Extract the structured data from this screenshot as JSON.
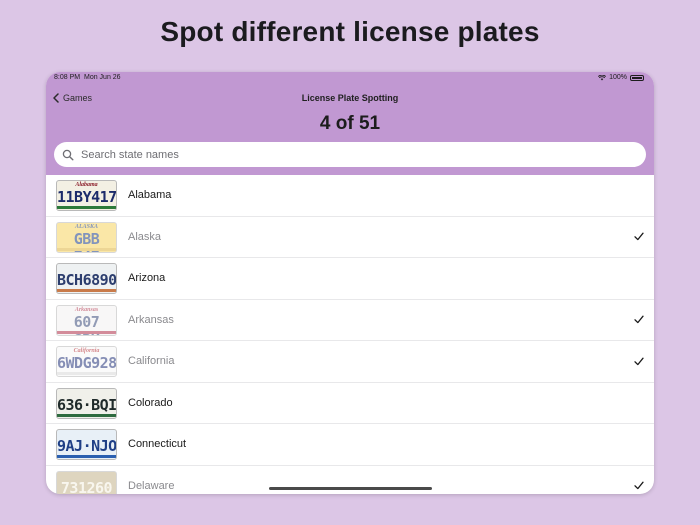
{
  "headline": "Spot different license plates",
  "status_bar": {
    "time": "8:08 PM",
    "date": "Mon Jun 26",
    "battery": "100%"
  },
  "nav": {
    "back_label": "Games",
    "title": "License Plate Spotting"
  },
  "progress": "4 of 51",
  "search": {
    "placeholder": "Search state names"
  },
  "states": [
    {
      "name": "Alabama",
      "spotted": false,
      "plate_text": "11BY417",
      "plate_top": "Alabama",
      "bg": "#f3f0e4",
      "text_color": "#1c2b6b",
      "top_color": "#8a1d2a",
      "accent": "#2c7a3a"
    },
    {
      "name": "Alaska",
      "spotted": true,
      "plate_text": "GBB 747",
      "plate_top": "ALASKA",
      "bg": "#f6d560",
      "text_color": "#1d3d86",
      "top_color": "#1d3d86",
      "accent": "#e0b640"
    },
    {
      "name": "Arizona",
      "spotted": false,
      "plate_text": "BCH6890",
      "plate_top": "",
      "bg": "#eef1f2",
      "text_color": "#2d3e6e",
      "top_color": "#2d3e6e",
      "accent": "#c97b4a"
    },
    {
      "name": "Arkansas",
      "spotted": true,
      "plate_text": "607 SBK",
      "plate_top": "Arkansas",
      "bg": "#f4f2f2",
      "text_color": "#3a4a7a",
      "top_color": "#b03048",
      "accent": "#b03048"
    },
    {
      "name": "California",
      "spotted": true,
      "plate_text": "6WDG928",
      "plate_top": "California",
      "bg": "#f7f7f7",
      "text_color": "#23337a",
      "top_color": "#b3262e",
      "accent": "#d8d8d8"
    },
    {
      "name": "Colorado",
      "spotted": false,
      "plate_text": "636·BQI",
      "plate_top": "",
      "bg": "#f0f0ea",
      "text_color": "#1f2a2a",
      "top_color": "#1f2a2a",
      "accent": "#2e6b3f"
    },
    {
      "name": "Connecticut",
      "spotted": false,
      "plate_text": "9AJ·NJO",
      "plate_top": "",
      "bg": "#e8f0f7",
      "text_color": "#1f3f86",
      "top_color": "#1f3f86",
      "accent": "#2a5fb0"
    },
    {
      "name": "Delaware",
      "spotted": true,
      "plate_text": "731260",
      "plate_top": "",
      "bg": "#c4b38a",
      "text_color": "#f3efe0",
      "top_color": "#f3efe0",
      "accent": "#2b3448"
    }
  ]
}
